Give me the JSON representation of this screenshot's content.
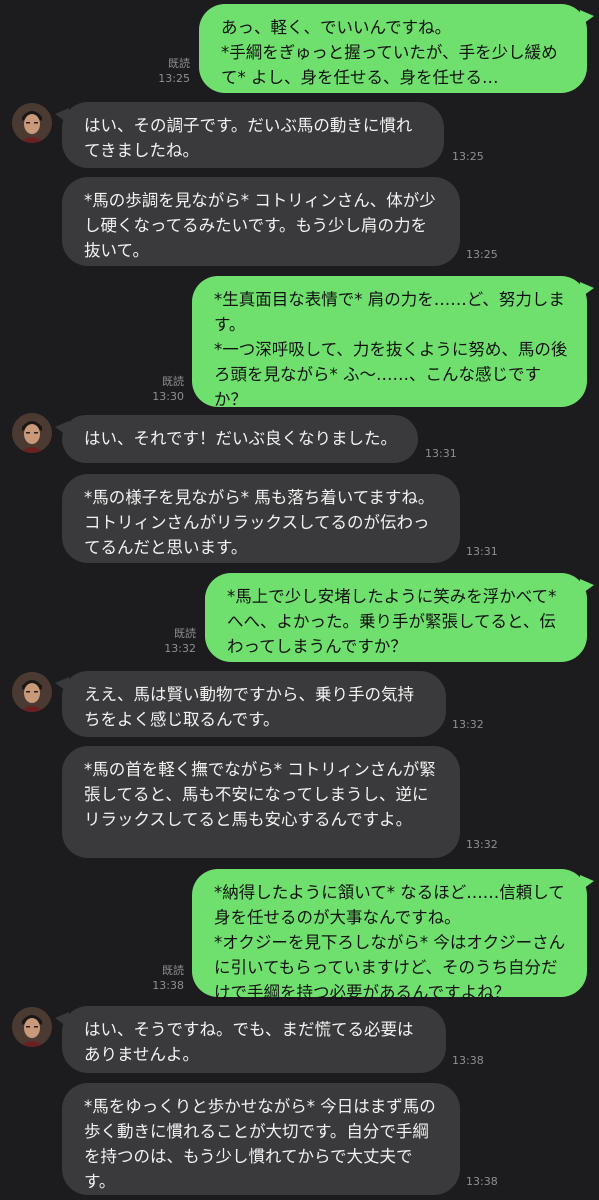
{
  "chat": {
    "read_label": "既読",
    "messages": [
      {
        "id": 1,
        "side": "out",
        "text": "あっ、軽く、でいいんですね。\n*手綱をぎゅっと握っていたが、手を少し緩めて* よし、身を任せる、身を任せる…",
        "time": "13:25",
        "read": true
      },
      {
        "id": 2,
        "side": "in",
        "avatar": true,
        "text": "はい、その調子です。だいぶ馬の動きに慣れてきましたね。",
        "time": "13:25"
      },
      {
        "id": 3,
        "side": "in",
        "avatar": false,
        "text": "*馬の歩調を見ながら* コトリィンさん、体が少し硬くなってるみたいです。もう少し肩の力を抜いて。",
        "time": "13:25"
      },
      {
        "id": 4,
        "side": "out",
        "text": "*生真面目な表情で* 肩の力を……ど、努力します。\n*一つ深呼吸して、力を抜くように努め、馬の後ろ頭を見ながら* ふ〜……、こんな感じですか？",
        "time": "13:30",
        "read": true
      },
      {
        "id": 5,
        "side": "in",
        "avatar": true,
        "text": "はい、それです！だいぶ良くなりました。",
        "time": "13:31"
      },
      {
        "id": 6,
        "side": "in",
        "avatar": false,
        "text": "*馬の様子を見ながら* 馬も落ち着いてますね。コトリィンさんがリラックスしてるのが伝わってるんだと思います。",
        "time": "13:31"
      },
      {
        "id": 7,
        "side": "out",
        "text": "*馬上で少し安堵したように笑みを浮かべて* へへ、よかった。乗り手が緊張してると、伝わってしまうんですか？",
        "time": "13:32",
        "read": true
      },
      {
        "id": 8,
        "side": "in",
        "avatar": true,
        "text": "ええ、馬は賢い動物ですから、乗り手の気持ちをよく感じ取るんです。",
        "time": "13:32"
      },
      {
        "id": 9,
        "side": "in",
        "avatar": false,
        "text": "*馬の首を軽く撫でながら* コトリィンさんが緊張してると、馬も不安になってしまうし、逆にリラックスしてると馬も安心するんですよ。",
        "time": "13:32"
      },
      {
        "id": 10,
        "side": "out",
        "text": "*納得したように頷いて* なるほど……信頼して身を任せるのが大事なんですね。\n*オクジーを見下ろしながら* 今はオクジーさんに引いてもらっていますけど、そのうち自分だけで手綱を持つ必要があるんですよね？",
        "time": "13:38",
        "read": true
      },
      {
        "id": 11,
        "side": "in",
        "avatar": true,
        "text": "はい、そうですね。でも、まだ慌てる必要はありませんよ。",
        "time": "13:38"
      },
      {
        "id": 12,
        "side": "in",
        "avatar": false,
        "text": "*馬をゆっくりと歩かせながら* 今日はまず馬の歩く動きに慣れることが大切です。自分で手綱を持つのは、もう少し慣れてからで大丈夫です。",
        "time": "13:38"
      }
    ]
  }
}
